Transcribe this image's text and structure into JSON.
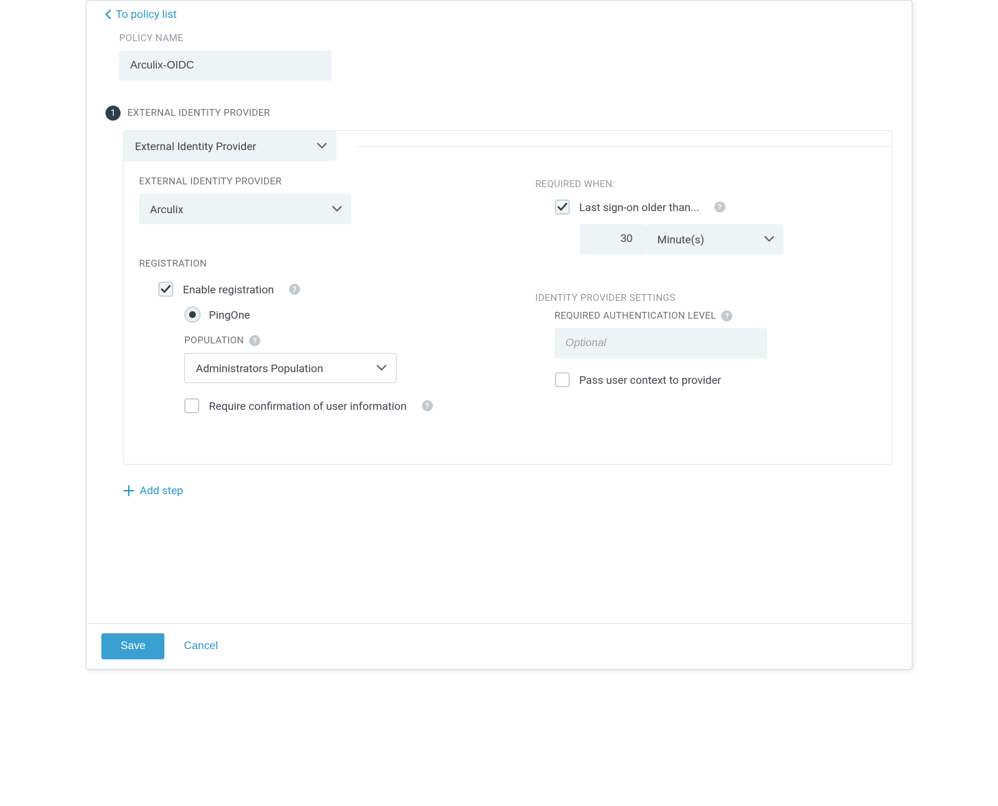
{
  "backLink": "To policy list",
  "policyName": {
    "label": "POLICY NAME",
    "value": "Arculix-OIDC"
  },
  "step1": {
    "number": "1",
    "title": "EXTERNAL IDENTITY PROVIDER",
    "typeSelect": "External Identity Provider",
    "left": {
      "eipLabel": "EXTERNAL IDENTITY PROVIDER",
      "eipValue": "Arculix",
      "registration": {
        "heading": "REGISTRATION",
        "enableLabel": "Enable registration",
        "enableChecked": true,
        "radioPingOne": "PingOne",
        "radioPingOneChecked": true,
        "populationLabel": "POPULATION",
        "populationValue": "Administrators Population",
        "requireConfirmLabel": "Require confirmation of user information",
        "requireConfirmChecked": false
      }
    },
    "right": {
      "requiredWhenLabel": "REQUIRED WHEN:",
      "lastSignonLabel": "Last sign-on older than...",
      "lastSignonChecked": true,
      "durationValue": "30",
      "durationUnit": "Minute(s)",
      "idpSettings": {
        "heading": "IDENTITY PROVIDER SETTINGS",
        "authLevelLabel": "REQUIRED AUTHENTICATION LEVEL",
        "authLevelPlaceholder": "Optional",
        "authLevelValue": "",
        "passContextLabel": "Pass user context to provider",
        "passContextChecked": false
      }
    }
  },
  "addStep": "Add step",
  "footer": {
    "save": "Save",
    "cancel": "Cancel"
  }
}
